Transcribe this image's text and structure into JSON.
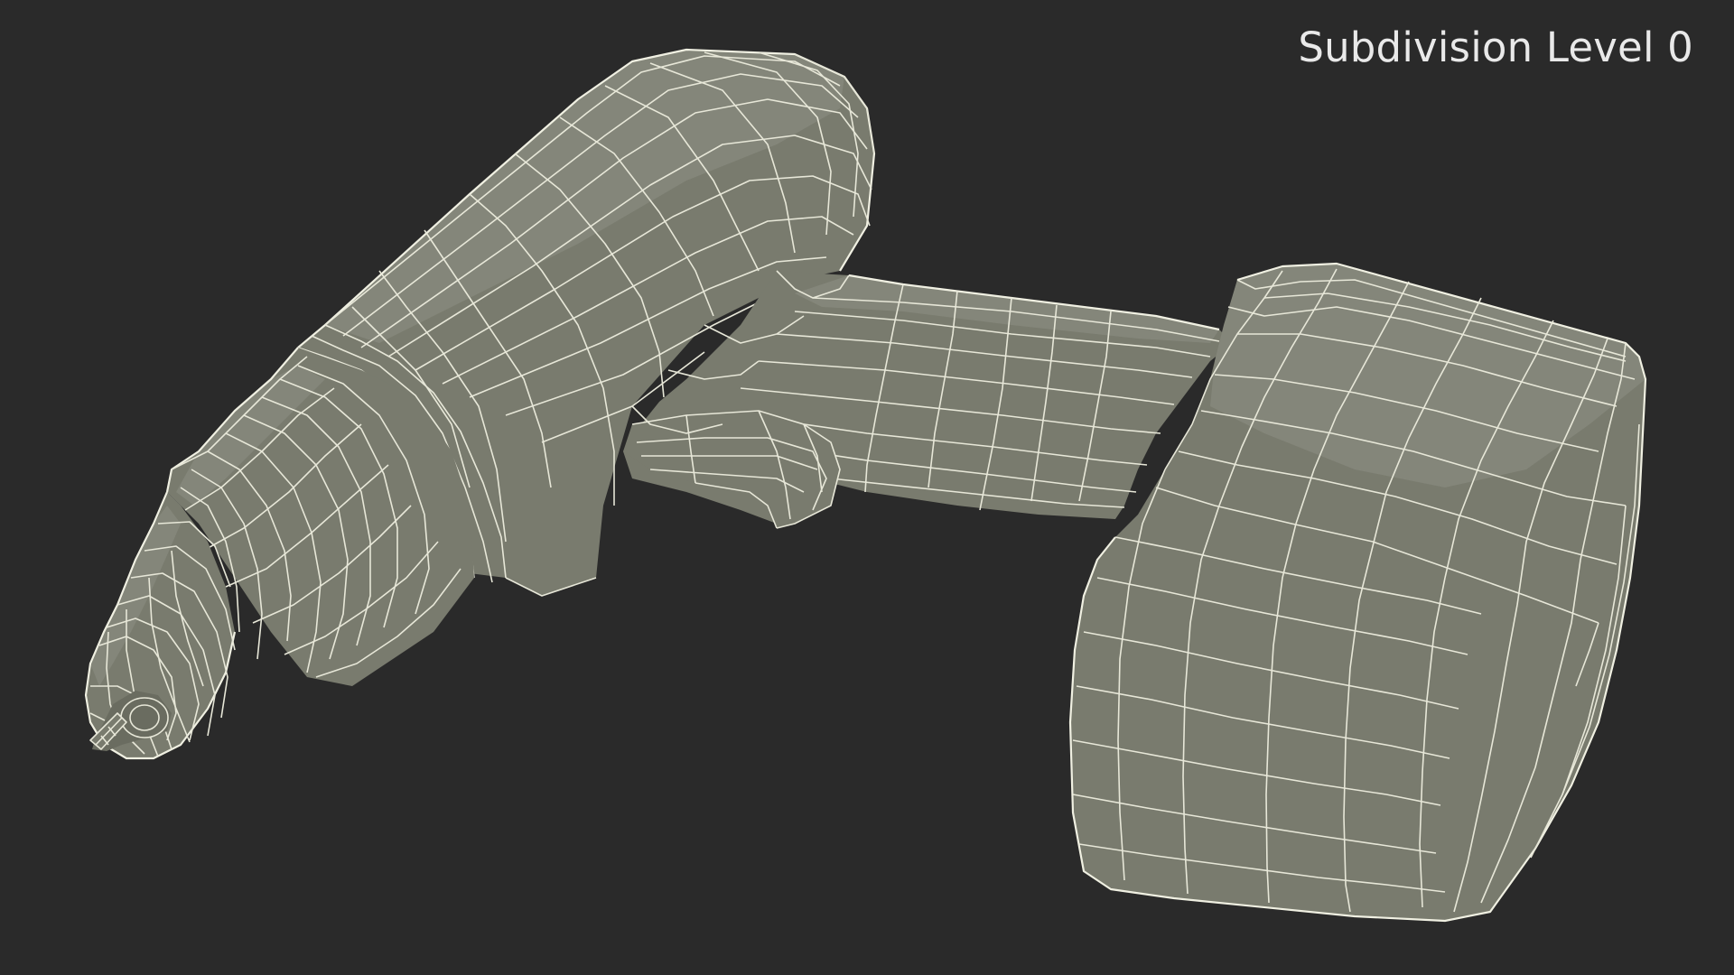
{
  "viewport": {
    "background_color": "#2a2a2a",
    "subdivision_label": "Subdivision Level 0",
    "label_color": "#e9e9e9"
  },
  "model": {
    "mesh_color": "#797b6e",
    "wire_color": "#e7e7d8"
  }
}
